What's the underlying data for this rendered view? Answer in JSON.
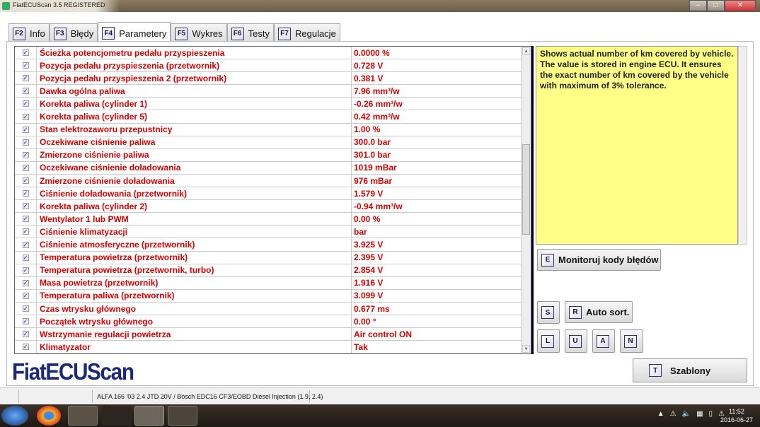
{
  "window": {
    "title": "FiatECUScan 3.5 REGISTERED"
  },
  "tabs": [
    {
      "key": "F2",
      "label": "Info"
    },
    {
      "key": "F3",
      "label": "Błędy"
    },
    {
      "key": "F4",
      "label": "Parametery",
      "active": true
    },
    {
      "key": "F5",
      "label": "Wykres"
    },
    {
      "key": "F6",
      "label": "Testy"
    },
    {
      "key": "F7",
      "label": "Regulacje"
    }
  ],
  "parameters": [
    {
      "name": "Ścieżka potencjometru pedału przyspieszenia",
      "value": "0.0000 %"
    },
    {
      "name": "Pozycja pedału przyspieszenia (przetwornik)",
      "value": "0.728 V"
    },
    {
      "name": "Pozycja pedału przyspieszenia 2 (przetwornik)",
      "value": "0.381 V"
    },
    {
      "name": "Dawka ogólna paliwa",
      "value": "7.96 mm³/w"
    },
    {
      "name": "Korekta paliwa (cylinder 1)",
      "value": "-0.26 mm³/w"
    },
    {
      "name": "Korekta paliwa (cylinder 5)",
      "value": "0.42 mm³/w"
    },
    {
      "name": "Stan elektrozaworu przepustnicy",
      "value": "1.00 %"
    },
    {
      "name": "Oczekiwane ciśnienie paliwa",
      "value": "300.0 bar"
    },
    {
      "name": "Zmierzone ciśnienie paliwa",
      "value": "301.0 bar"
    },
    {
      "name": "Oczekiwane ciśnienie doładowania",
      "value": "1019 mBar"
    },
    {
      "name": "Zmierzone ciśnienie doładowania",
      "value": "976 mBar"
    },
    {
      "name": "Ciśnienie doładowania (przetwornik)",
      "value": "1.579 V"
    },
    {
      "name": "Korekta paliwa (cylinder 2)",
      "value": "-0.94 mm³/w"
    },
    {
      "name": "Wentylator 1 lub PWM",
      "value": "0.00 %"
    },
    {
      "name": "Ciśnienie klimatyzacji",
      "value": " bar"
    },
    {
      "name": "Ciśnienie atmosferyczne (przetwornik)",
      "value": "3.925 V"
    },
    {
      "name": "Temperatura powietrza (przetwornik)",
      "value": "2.395 V"
    },
    {
      "name": "Temperatura powietrza (przetwornik, turbo)",
      "value": "2.854 V"
    },
    {
      "name": "Masa powietrza (przetwornik)",
      "value": "1.916 V"
    },
    {
      "name": "Temperatura paliwa (przetwornik)",
      "value": "3.099 V"
    },
    {
      "name": "Czas wtrysku głównego",
      "value": "0.677 ms"
    },
    {
      "name": "Początek wtrysku głównego",
      "value": "0.00 °"
    },
    {
      "name": "Wstrzymanie regulacji powietrza",
      "value": "Air control ON"
    },
    {
      "name": "Klimatyzator",
      "value": "Tak"
    }
  ],
  "info_text": "Shows actual number of km covered by vehicle. The value is stored in engine ECU. It ensures the exact number of km covered by the vehicle with maximum of 3% tolerance.",
  "buttons": {
    "monitor": {
      "key": "E",
      "label": "Monitoruj kody błędów"
    },
    "s": {
      "key": "S"
    },
    "autosort": {
      "key": "R",
      "label": "Auto sort."
    },
    "l": {
      "key": "L"
    },
    "u": {
      "key": "U"
    },
    "a": {
      "key": "A"
    },
    "n": {
      "key": "N"
    },
    "templates": {
      "key": "T",
      "label": "Szablony"
    }
  },
  "logo": "FiatECUScan",
  "status": {
    "vehicle": "ALFA 166 '03 2.4 JTD 20V / Bosch EDC16 CF3/EOBD Diesel Injection (1.9, 2.4)"
  },
  "taskbar": {
    "time": "11:52",
    "date": "2016-06-27"
  }
}
